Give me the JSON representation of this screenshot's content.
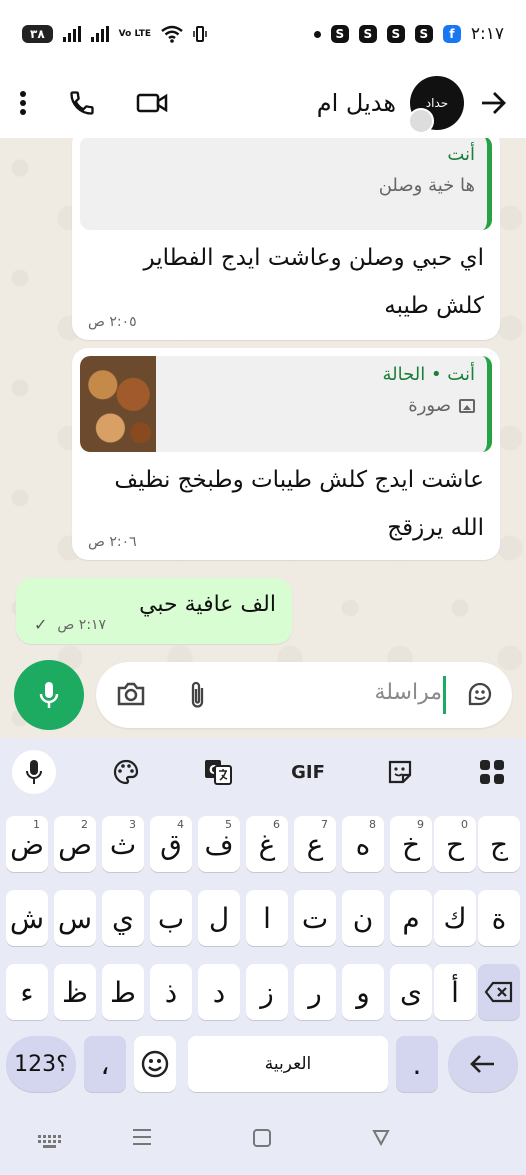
{
  "status_bar": {
    "time": "٢:١٧",
    "battery": "٣٨",
    "network_label": "Vo LTE",
    "notification_letters": [
      "S",
      "S",
      "S",
      "S"
    ]
  },
  "header": {
    "contact_name": "هديل ام",
    "avatar_text": "حداد",
    "icons": [
      "more-vert-icon",
      "phone-icon",
      "video-call-icon",
      "back-arrow-icon"
    ]
  },
  "messages": [
    {
      "type": "incoming",
      "quote_author": "أنت",
      "quote_text": "ها خية وصلن",
      "text_line1": "اي حبي وصلن وعاشت ايدج الفطاير",
      "text_line2": "كلش طيبه",
      "time": "٢:٠٥ ص"
    },
    {
      "type": "incoming",
      "quote_author": "أنت • الحالة",
      "quote_text": "صورة",
      "text_line1": "عاشت ايدج كلش طيبات وطبخج نظيف",
      "text_line2": "الله يرزقج",
      "time": "٢:٠٦ ص"
    },
    {
      "type": "outgoing",
      "text": "الف عافية حبي",
      "time": "٢:١٧ ص",
      "status": "sent-check"
    }
  ],
  "composer": {
    "placeholder": "مراسلة",
    "icons": [
      "mic-icon",
      "camera-icon",
      "attach-icon",
      "sticker-icon"
    ]
  },
  "keyboard": {
    "toolbar": {
      "gif_label": "GIF",
      "icons": [
        "mic-icon",
        "palette-icon",
        "translate-icon",
        "sticker-icon",
        "grid-icon"
      ]
    },
    "row1": [
      {
        "k": "ض",
        "n": "1"
      },
      {
        "k": "ص",
        "n": "2"
      },
      {
        "k": "ث",
        "n": "3"
      },
      {
        "k": "ق",
        "n": "4"
      },
      {
        "k": "ف",
        "n": "5"
      },
      {
        "k": "غ",
        "n": "6"
      },
      {
        "k": "ع",
        "n": "7"
      },
      {
        "k": "ه",
        "n": "8"
      },
      {
        "k": "خ",
        "n": "9"
      },
      {
        "k": "ح",
        "n": "0"
      },
      {
        "k": "ج",
        "n": ""
      }
    ],
    "row2": [
      "ش",
      "س",
      "ي",
      "ب",
      "ل",
      "ا",
      "ت",
      "ن",
      "م",
      "ك",
      "ة"
    ],
    "row3": [
      "ء",
      "ظ",
      "ط",
      "ذ",
      "د",
      "ز",
      "ر",
      "و",
      "ى",
      "أ"
    ],
    "row4": {
      "symbols": "؟123",
      "comma": "،",
      "space_label": "العربية",
      "period": "."
    }
  }
}
